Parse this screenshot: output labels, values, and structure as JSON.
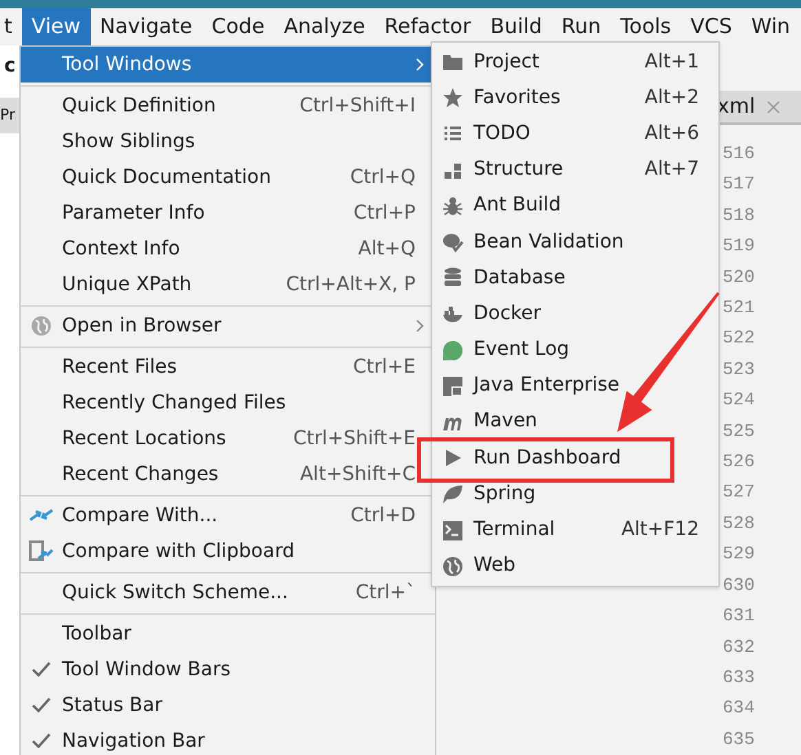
{
  "menu_bar": {
    "items": [
      {
        "label": "t",
        "selected": false
      },
      {
        "label": "View",
        "selected": true
      },
      {
        "label": "Navigate",
        "selected": false
      },
      {
        "label": "Code",
        "selected": false
      },
      {
        "label": "Analyze",
        "selected": false
      },
      {
        "label": "Refactor",
        "selected": false
      },
      {
        "label": "Build",
        "selected": false
      },
      {
        "label": "Run",
        "selected": false
      },
      {
        "label": "Tools",
        "selected": false
      },
      {
        "label": "VCS",
        "selected": false
      },
      {
        "label": "Win",
        "selected": false
      }
    ]
  },
  "background": {
    "left_texts": [
      "c",
      "Pr"
    ],
    "editor_tab": {
      "label": "xml"
    },
    "line_numbers": [
      "516",
      "517",
      "518",
      "519",
      "520",
      "521",
      "522",
      "523",
      "524",
      "525",
      "526",
      "527",
      "528",
      "529",
      "630",
      "631",
      "632",
      "633",
      "634",
      "635"
    ]
  },
  "view_menu": {
    "items": [
      {
        "kind": "item",
        "label": "Tool Windows",
        "submenu": true,
        "selected": true,
        "checked": false
      },
      {
        "kind": "separator"
      },
      {
        "kind": "item",
        "label": "Quick Definition",
        "shortcut": "Ctrl+Shift+I",
        "submenu": false,
        "selected": false,
        "checked": false
      },
      {
        "kind": "item",
        "label": "Show Siblings",
        "submenu": false,
        "selected": false,
        "checked": false
      },
      {
        "kind": "item",
        "label": "Quick Documentation",
        "shortcut": "Ctrl+Q",
        "submenu": false,
        "selected": false,
        "checked": false
      },
      {
        "kind": "item",
        "label": "Parameter Info",
        "shortcut": "Ctrl+P",
        "submenu": false,
        "selected": false,
        "checked": false
      },
      {
        "kind": "item",
        "label": "Context Info",
        "shortcut": "Alt+Q",
        "submenu": false,
        "selected": false,
        "checked": false
      },
      {
        "kind": "item",
        "label": "Unique XPath",
        "shortcut": "Ctrl+Alt+X, P",
        "submenu": false,
        "selected": false,
        "checked": false
      },
      {
        "kind": "separator"
      },
      {
        "kind": "item",
        "label": "Open in Browser",
        "submenu": true,
        "selected": false,
        "checked": false
      },
      {
        "kind": "separator"
      },
      {
        "kind": "item",
        "label": "Recent Files",
        "shortcut": "Ctrl+E",
        "submenu": false,
        "selected": false,
        "checked": false
      },
      {
        "kind": "item",
        "label": "Recently Changed Files",
        "submenu": false,
        "selected": false,
        "checked": false
      },
      {
        "kind": "item",
        "label": "Recent Locations",
        "shortcut": "Ctrl+Shift+E",
        "submenu": false,
        "selected": false,
        "checked": false
      },
      {
        "kind": "item",
        "label": "Recent Changes",
        "shortcut": "Alt+Shift+C",
        "submenu": false,
        "selected": false,
        "checked": false
      },
      {
        "kind": "separator"
      },
      {
        "kind": "item",
        "label": "Compare With...",
        "shortcut": "Ctrl+D",
        "submenu": false,
        "selected": false,
        "checked": false
      },
      {
        "kind": "item",
        "label": "Compare with Clipboard",
        "submenu": false,
        "selected": false,
        "checked": false
      },
      {
        "kind": "separator"
      },
      {
        "kind": "item",
        "label": "Quick Switch Scheme...",
        "shortcut": "Ctrl+`",
        "submenu": false,
        "selected": false,
        "checked": false
      },
      {
        "kind": "separator"
      },
      {
        "kind": "item",
        "label": "Toolbar",
        "submenu": false,
        "selected": false,
        "checked": false
      },
      {
        "kind": "item",
        "label": "Tool Window Bars",
        "submenu": false,
        "selected": false,
        "checked": true
      },
      {
        "kind": "item",
        "label": "Status Bar",
        "submenu": false,
        "selected": false,
        "checked": true
      },
      {
        "kind": "item",
        "label": "Navigation Bar",
        "submenu": false,
        "selected": false,
        "checked": true
      }
    ]
  },
  "tool_windows_menu": {
    "items": [
      {
        "label": "Project",
        "shortcut": "Alt+1"
      },
      {
        "label": "Favorites",
        "shortcut": "Alt+2"
      },
      {
        "label": "TODO",
        "shortcut": "Alt+6"
      },
      {
        "label": "Structure",
        "shortcut": "Alt+7"
      },
      {
        "label": "Ant Build"
      },
      {
        "label": "Bean Validation"
      },
      {
        "label": "Database"
      },
      {
        "label": "Docker"
      },
      {
        "label": "Event Log"
      },
      {
        "label": "Java Enterprise"
      },
      {
        "label": "Maven"
      },
      {
        "label": "Run Dashboard"
      },
      {
        "label": "Spring"
      },
      {
        "label": "Terminal",
        "shortcut": "Alt+F12"
      },
      {
        "label": "Web"
      }
    ]
  }
}
